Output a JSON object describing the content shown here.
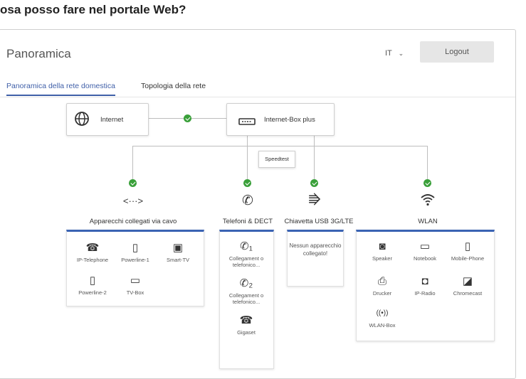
{
  "page_heading": "osa posso fare nel portale Web?",
  "header": {
    "title": "Panoramica",
    "language": "IT",
    "logout_label": "Logout"
  },
  "tabs": [
    {
      "label": "Panoramica della rete domestica",
      "active": true
    },
    {
      "label": "Topologia della rete",
      "active": false
    }
  ],
  "internet_node": {
    "label": "Internet",
    "icon": "globe-icon"
  },
  "box_node": {
    "label": "Internet-Box plus",
    "icon": "router-icon"
  },
  "speedtest_label": "Speedtest",
  "categories": [
    {
      "label": "Apparecchi collegati via cavo",
      "icon": "code-icon",
      "glyph": "<···>",
      "status": "ok"
    },
    {
      "label": "Telefoni & DECT",
      "icon": "phone-icon",
      "glyph": "✆",
      "status": "ok"
    },
    {
      "label": "Chiavetta USB 3G/LTE",
      "icon": "usb-icon",
      "glyph": "⭆",
      "status": "ok"
    },
    {
      "label": "WLAN",
      "icon": "wifi-icon",
      "glyph": "◠",
      "status": "ok"
    }
  ],
  "cable_devices": [
    {
      "label": "IP-Telephone",
      "icon": "desk-phone-icon",
      "glyph": "☎"
    },
    {
      "label": "Powerline-1",
      "icon": "plug-icon",
      "glyph": "▯"
    },
    {
      "label": "Smart-TV",
      "icon": "tv-icon",
      "glyph": "▣"
    },
    {
      "label": "Powerline-2",
      "icon": "plug-icon",
      "glyph": "▯"
    },
    {
      "label": "TV-Box",
      "icon": "tv-box-icon",
      "glyph": "▭"
    }
  ],
  "phone_devices": [
    {
      "label": "Collegament o telefonico...",
      "icon": "phone-line-1-icon",
      "glyph": "✆₁"
    },
    {
      "label": "Collegament o telefonico...",
      "icon": "phone-line-2-icon",
      "glyph": "✆₂"
    },
    {
      "label": "Gigaset",
      "icon": "desk-phone-icon",
      "glyph": "☎"
    }
  ],
  "usb_empty_text": "Nessun apparecchio collegato!",
  "wlan_devices": [
    {
      "label": "Speaker",
      "icon": "speaker-icon",
      "glyph": "◙"
    },
    {
      "label": "Notebook",
      "icon": "laptop-icon",
      "glyph": "▭"
    },
    {
      "label": "Mobile-Phone",
      "icon": "mobile-icon",
      "glyph": "▯"
    },
    {
      "label": "Drucker",
      "icon": "printer-icon",
      "glyph": "⎙"
    },
    {
      "label": "IP-Radio",
      "icon": "radio-icon",
      "glyph": "◘"
    },
    {
      "label": "Chromecast",
      "icon": "cast-icon",
      "glyph": "◪"
    },
    {
      "label": "WLAN-Box",
      "icon": "wlan-box-icon",
      "glyph": "((•))"
    }
  ],
  "colors": {
    "accent": "#3a63b3",
    "ok": "#3aa03a",
    "button_bg": "#e6e6e6"
  }
}
